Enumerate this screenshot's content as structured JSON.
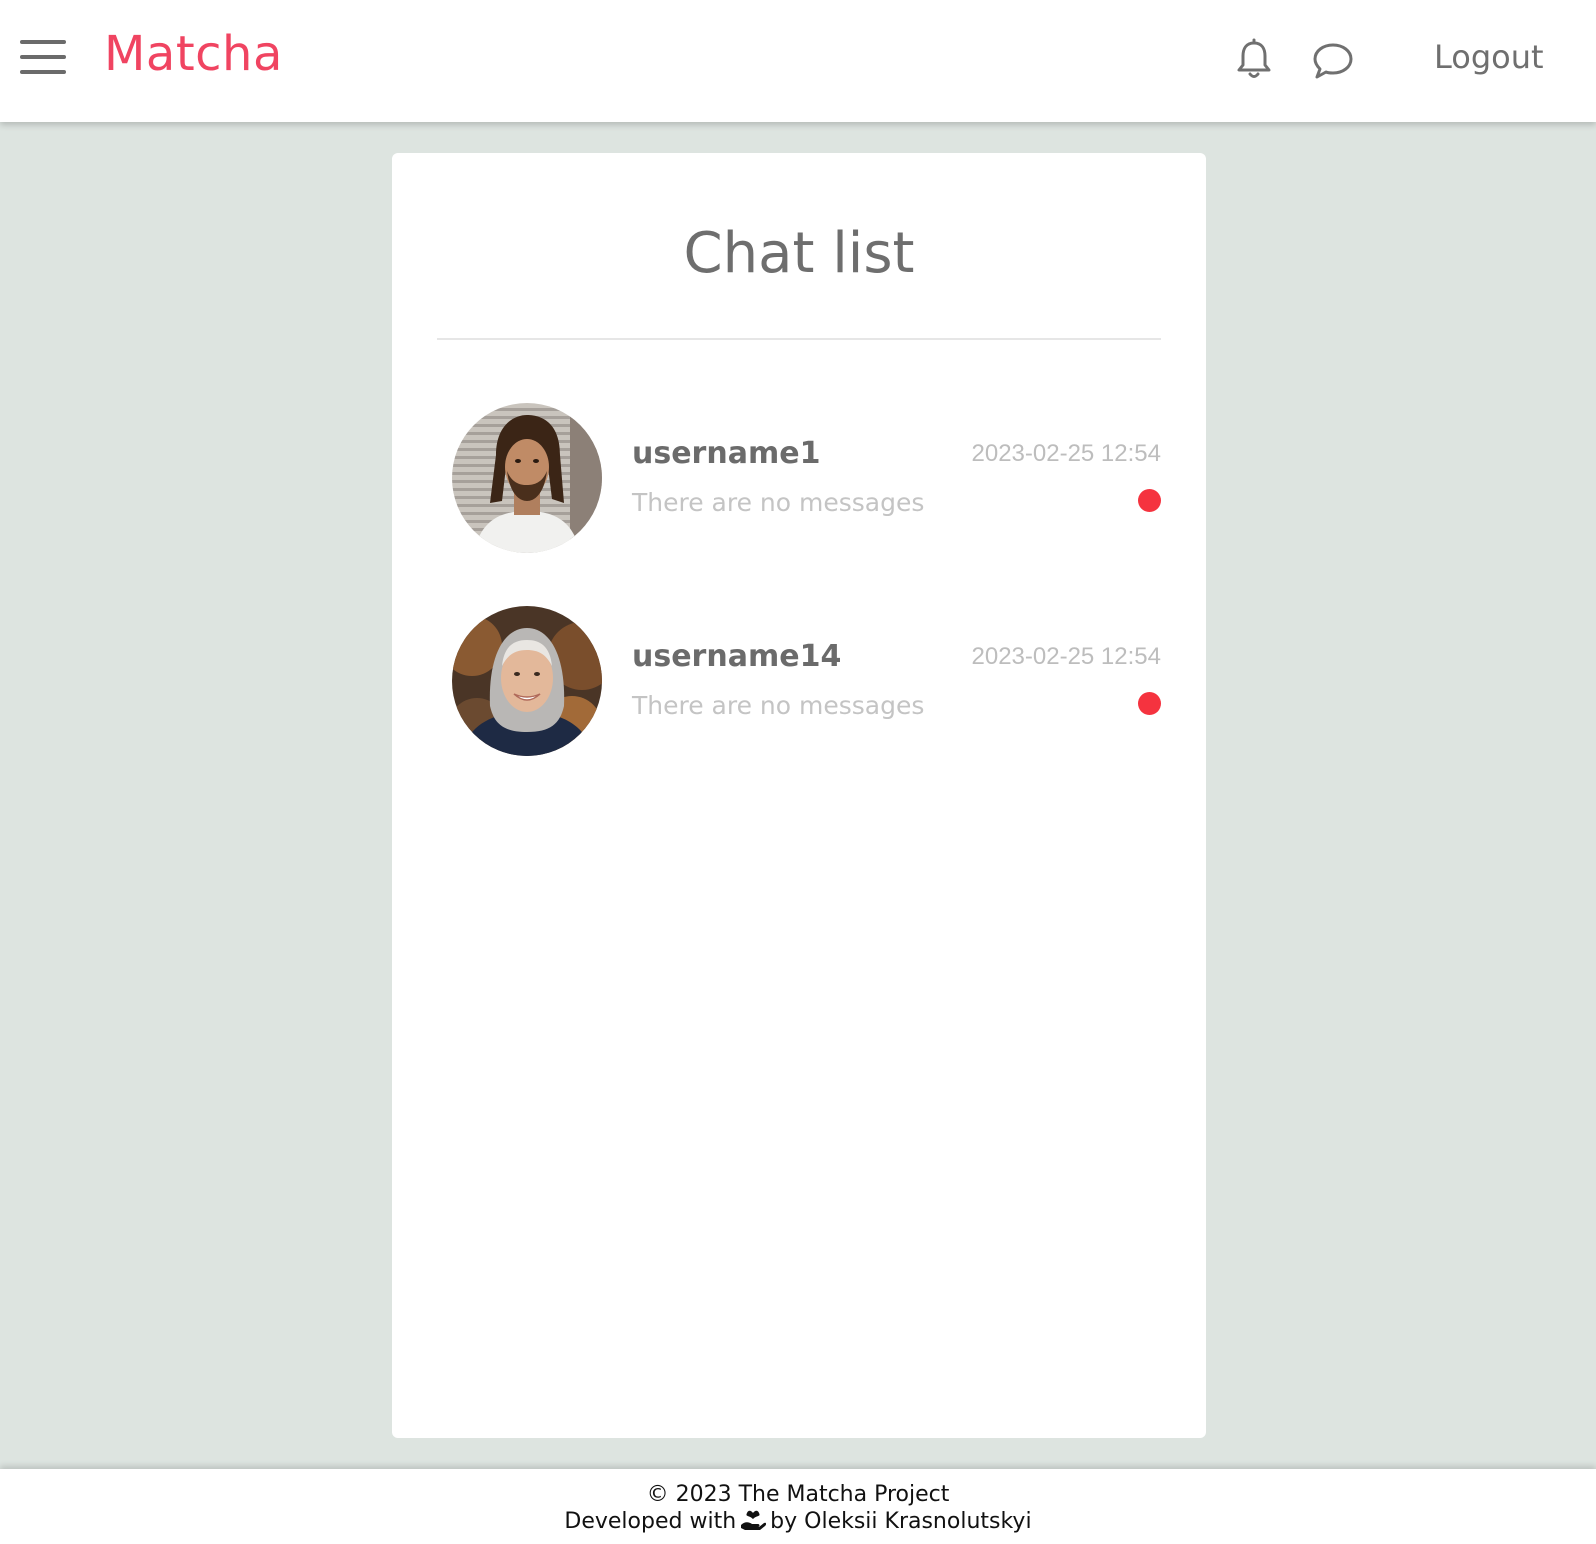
{
  "header": {
    "brand": "Matcha",
    "logout_label": "Logout",
    "icons": [
      "hamburger-menu-icon",
      "bell-icon",
      "chat-bubble-icon"
    ],
    "brand_color": "#f04461"
  },
  "main": {
    "title": "Chat list",
    "chats": [
      {
        "username": "username1",
        "timestamp": "2023-02-25 12:54",
        "preview": "There are no messages",
        "status_color": "#f5333f"
      },
      {
        "username": "username14",
        "timestamp": "2023-02-25 12:54",
        "preview": "There are no messages",
        "status_color": "#f5333f"
      }
    ]
  },
  "footer": {
    "copyright": "© 2023 The Matcha Project",
    "developed_prefix": "Developed with",
    "developed_suffix": "by Oleksii Krasnolutskyi",
    "icon": "heart-hand-icon"
  },
  "colors": {
    "background": "#dde4e0",
    "card": "#ffffff",
    "status_dot": "#f5333f"
  }
}
